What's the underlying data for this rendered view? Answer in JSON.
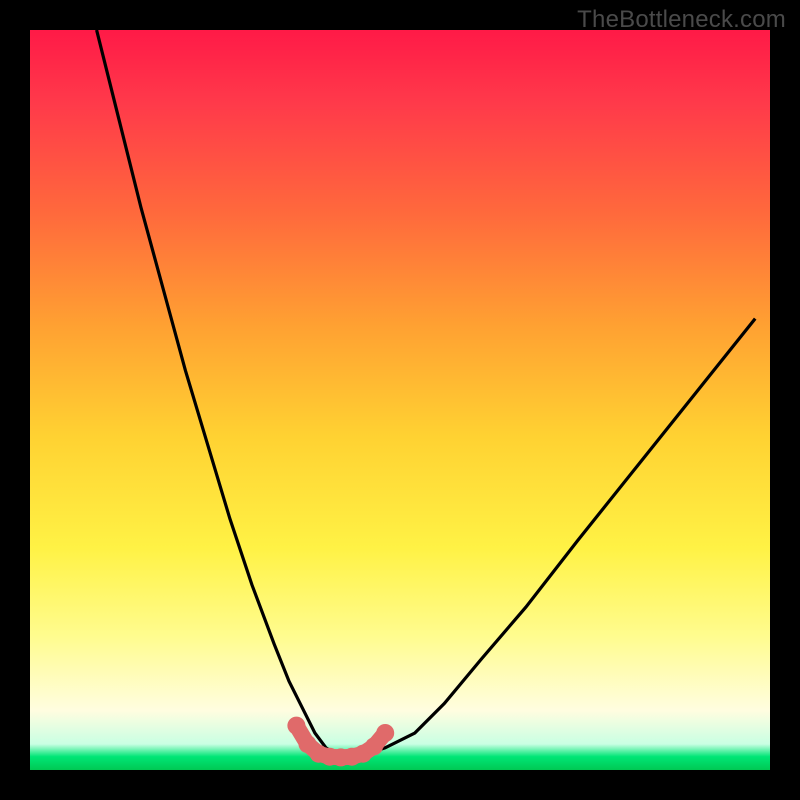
{
  "watermark": "TheBottleneck.com",
  "chart_data": {
    "type": "line",
    "title": "",
    "xlabel": "",
    "ylabel": "",
    "xlim": [
      0,
      100
    ],
    "ylim": [
      0,
      100
    ],
    "series": [
      {
        "name": "curve",
        "x": [
          9,
          12,
          15,
          18,
          21,
          24,
          27,
          30,
          33,
          35,
          37,
          38.5,
          40,
          41.5,
          43,
          45,
          48,
          52,
          56,
          61,
          67,
          74,
          82,
          90,
          98
        ],
        "y": [
          100,
          88,
          76,
          65,
          54,
          44,
          34,
          25,
          17,
          12,
          8,
          5,
          3,
          2,
          2,
          2,
          3,
          5,
          9,
          15,
          22,
          31,
          41,
          51,
          61
        ]
      },
      {
        "name": "valley-marker",
        "x": [
          36,
          37.5,
          39,
          40.5,
          42,
          43.5,
          45,
          46.5,
          48
        ],
        "y": [
          6,
          3.5,
          2.2,
          1.8,
          1.7,
          1.8,
          2.2,
          3.2,
          5
        ]
      }
    ],
    "colors": {
      "curve": "#000000",
      "valley_marker": "#e06a6a"
    },
    "gradient_stops": [
      {
        "pos": 0,
        "color": "#ff1a47"
      },
      {
        "pos": 0.25,
        "color": "#ff6a3c"
      },
      {
        "pos": 0.55,
        "color": "#ffd232"
      },
      {
        "pos": 0.82,
        "color": "#fffc8f"
      },
      {
        "pos": 0.965,
        "color": "#c9ffe3"
      },
      {
        "pos": 1.0,
        "color": "#00c853"
      }
    ]
  }
}
